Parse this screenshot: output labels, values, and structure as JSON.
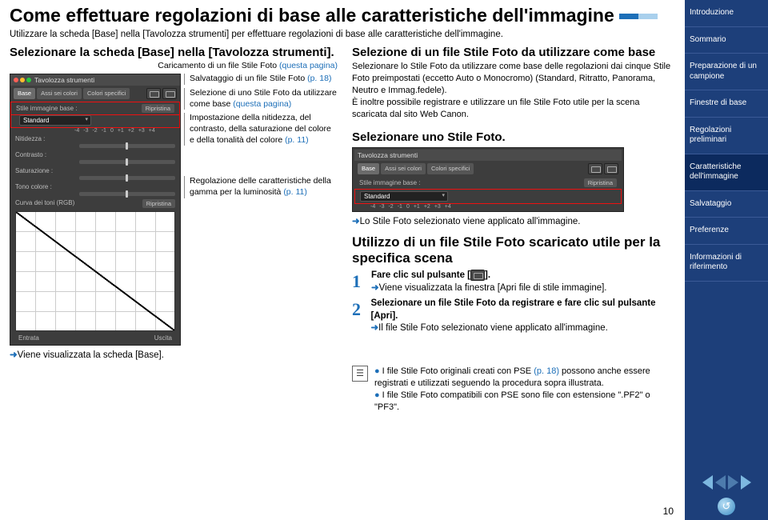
{
  "title": "Come effettuare regolazioni di base alle caratteristiche dell'immagine",
  "intro": "Utilizzare la scheda [Base] nella [Tavolozza strumenti] per effettuare regolazioni di base alle caratteristiche dell'immagine.",
  "left": {
    "h2": "Selezionare la scheda [Base] nella [Tavolozza strumenti].",
    "caption": "Caricamento di un file Stile Foto ",
    "caption_link": "(questa pagina)",
    "result": "Viene visualizzata la scheda [Base]."
  },
  "palette": {
    "title": "Tavolozza strumenti",
    "tabs": [
      "Base",
      "Assi sei colori",
      "Colori specifici"
    ],
    "stile_label": "Stile immagine base :",
    "stile_value": "Standard",
    "ripristina": "Ripristina",
    "sliders": [
      "Nitidezza :",
      "Contrasto :",
      "Saturazione :",
      "Tono colore :"
    ],
    "scale": [
      "-4",
      "-3",
      "-2",
      "-1",
      "0",
      "+1",
      "+2",
      "+3",
      "+4"
    ],
    "curve_label": "Curva dei toni (RGB)",
    "entrata": "Entrata",
    "uscita": "Uscita"
  },
  "annotations": {
    "a1a": "Salvataggio di un file Stile Foto ",
    "a1b": "(p. 18)",
    "a2a": "Selezione di uno Stile Foto da utilizzare come base ",
    "a2b": "(questa pagina)",
    "a3a": "Impostazione della nitidezza, del contrasto, della saturazione del colore e della tonalità del colore ",
    "a3b": "(p. 11)",
    "a4a": "Regolazione delle caratteristiche della gamma per la luminosità ",
    "a4b": "(p. 11)"
  },
  "right": {
    "h2": "Selezione di un file Stile Foto da utilizzare come base",
    "p1": "Selezionare lo Stile Foto da utilizzare come base delle regolazioni dai cinque Stile Foto preimpostati (eccetto Auto o Monocromo) (Standard, Ritratto, Panorama, Neutro e Immag.fedele).",
    "p2": "È inoltre possibile registrare e utilizzare un file Stile Foto utile per la scena scaricata dal sito Web Canon.",
    "h2b": "Selezionare uno Stile Foto.",
    "applied": "Lo Stile Foto selezionato viene applicato all'immagine.",
    "h3": "Utilizzo di un file Stile Foto scaricato utile per la specifica scena",
    "s1a": "Fare clic sul pulsante [",
    "s1b": "].",
    "s1r": "Viene visualizzata la finestra [Apri file di stile immagine].",
    "s2": "Selezionare un file Stile Foto da registrare e fare clic sul pulsante [Apri].",
    "s2r": "Il file Stile Foto selezionato viene applicato all'immagine."
  },
  "notes": {
    "n1a": "I file Stile Foto originali creati con PSE ",
    "n1b": "(p. 18)",
    "n1c": " possono anche essere registrati e utilizzati seguendo la procedura sopra illustrata.",
    "n2": "I file Stile Foto compatibili con PSE sono file con estensione \".PF2\" o \"PF3\"."
  },
  "side": [
    "Introduzione",
    "Sommario",
    "Preparazione di un campione",
    "Finestre di base",
    "Regolazioni preliminari",
    "Caratteristiche dell'immagine",
    "Salvataggio",
    "Preferenze",
    "Informazioni di riferimento"
  ],
  "active_side_index": 5,
  "page_number": "10"
}
